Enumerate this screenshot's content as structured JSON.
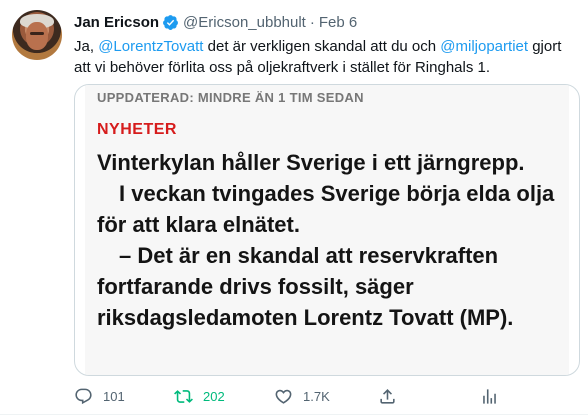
{
  "tweet": {
    "author_name": "Jan Ericson",
    "handle": "@Ericson_ubbhult",
    "separator": "·",
    "date": "Feb 6",
    "text_parts": {
      "p1": "Ja, ",
      "mention1": "@LorentzTovatt",
      "p2": " det är verkligen skandal att du och ",
      "mention2": "@miljopartiet",
      "p3": " gjort att vi behöver förlita oss på oljekraftverk i stället för Ringhals 1."
    }
  },
  "media": {
    "updated": "UPPDATERAD: MINDRE ÄN 1 TIM SEDAN",
    "kicker": "NYHETER",
    "para1": "Vinterkylan håller Sverige i ett järngrepp.",
    "para2": "I veckan tvingades Sverige börja elda olja för att klara elnätet.",
    "para3": "– Det är en skandal att reservkraften fortfarande drivs fossilt, säger riksdagsledamoten Lorentz Tovatt (MP)."
  },
  "actions": {
    "reply_count": "101",
    "retweet_count": "202",
    "like_count": "1.7K",
    "icons": [
      "reply-icon",
      "retweet-icon",
      "like-icon",
      "share-icon",
      "analytics-icon"
    ],
    "retweet_color": "#00ba7c"
  },
  "colors": {
    "link": "#1d9bf0",
    "secondary_text": "#536471",
    "kicker": "#d61c1c",
    "verified": "#1d9bf0"
  }
}
